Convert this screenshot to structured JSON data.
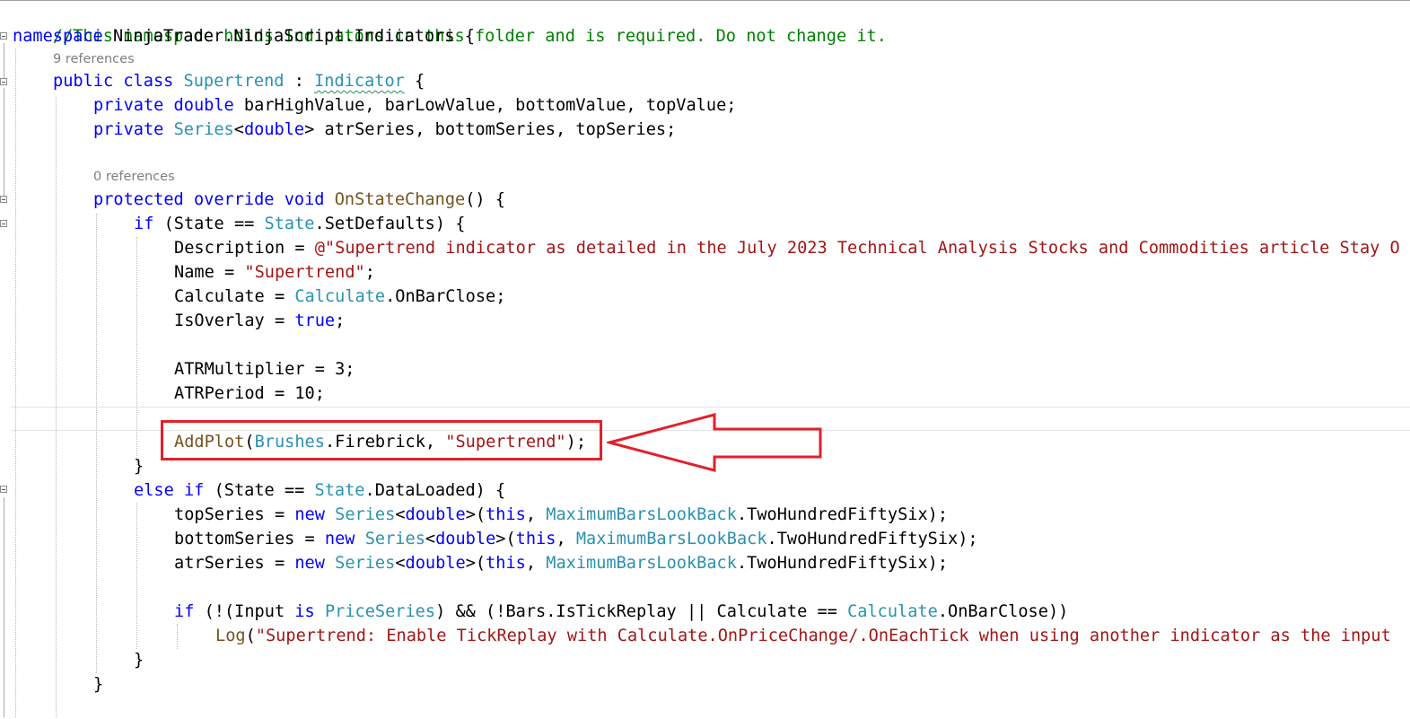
{
  "code_lines": {
    "l1": "//This namespace holds Indicators in this folder and is required. Do not change it.",
    "l2_kw": "namespace",
    "l2_rest": " NinjaTrader.NinjaScript.Indicators {",
    "ref1": "9 references",
    "l3_kw": "public class",
    "l3_name": "Supertrend",
    "l3_sep": " : ",
    "l3_base": "Indicator",
    "l3_end": " {",
    "l4_kw": "private double",
    "l4_rest": " barHighValue, barLowValue, bottomValue, topValue;",
    "l5_kw": "private",
    "l5_type": "Series",
    "l5_lt": "<",
    "l5_dbl": "double",
    "l5_rest": "> atrSeries, bottomSeries, topSeries;",
    "ref2": "0 references",
    "l6_kw": "protected override void",
    "l6_method": "OnStateChange",
    "l6_rest": "() {",
    "l7_kw": "if",
    "l7_a": " (State == ",
    "l7_type": "State",
    "l7_b": ".SetDefaults) {",
    "l8_a": "Description = ",
    "l8_str": "@\"Supertrend indicator as detailed in the July 2023 Technical Analysis Stocks and Commodities article Stay O",
    "l9_a": "Name = ",
    "l9_str": "\"Supertrend\"",
    "l9_end": ";",
    "l10_a": "Calculate = ",
    "l10_type": "Calculate",
    "l10_b": ".OnBarClose;",
    "l11_a": "IsOverlay = ",
    "l11_kw": "true",
    "l11_end": ";",
    "l12": "ATRMultiplier = 3;",
    "l13": "ATRPeriod = 10;",
    "l14_method": "AddPlot",
    "l14_a": "(",
    "l14_type": "Brushes",
    "l14_b": ".Firebrick, ",
    "l14_str": "\"Supertrend\"",
    "l14_end": ");",
    "l15": "}",
    "l16_kw": "else if",
    "l16_a": " (State == ",
    "l16_type": "State",
    "l16_b": ".DataLoaded) {",
    "l17_a": "topSeries = ",
    "l18_a": "bottomSeries = ",
    "l19_a": "atrSeries = ",
    "new_kw": "new",
    "series_type": "Series",
    "series_lt": "<",
    "double_kw": "double",
    "series_gt": ">(",
    "this_kw": "this",
    "comma": ", ",
    "mblb_type": "MaximumBarsLookBack",
    "mblb_rest": ".TwoHundredFiftySix);",
    "l20_kw": "if",
    "l20_a": " (!(Input ",
    "l20_is": "is",
    "l20_type": "PriceSeries",
    "l20_b": ") && (!Bars.IsTickReplay || Calculate == ",
    "l20_type2": "Calculate",
    "l20_c": ".OnBarClose))",
    "l21_method": "Log",
    "l21_a": "(",
    "l21_str": "\"Supertrend: Enable TickReplay with Calculate.OnPriceChange/.OnEachTick when using another indicator as the input",
    "l22": "}",
    "l23": "}"
  },
  "annotation": {
    "box_color": "#e3202a",
    "arrow_color": "#e3202a"
  },
  "colors": {
    "keyword": "#0000ff",
    "type": "#2b91af",
    "method": "#74531f",
    "string": "#a31515",
    "comment": "#008000"
  }
}
